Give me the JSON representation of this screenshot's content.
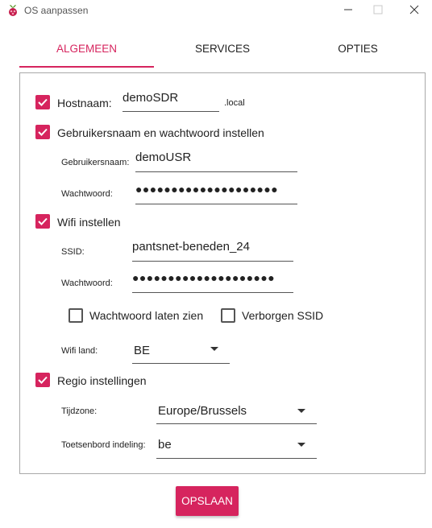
{
  "window": {
    "title": "OS aanpassen"
  },
  "tabs": [
    {
      "label": "ALGEMEEN",
      "active": true
    },
    {
      "label": "SERVICES",
      "active": false
    },
    {
      "label": "OPTIES",
      "active": false
    }
  ],
  "hostname": {
    "checked": true,
    "label": "Hostnaam:",
    "value": "demoSDR",
    "suffix": ".local"
  },
  "user": {
    "checked": true,
    "label": "Gebruikersnaam en wachtwoord instellen",
    "username_label": "Gebruikersnaam:",
    "username_value": "demoUSR",
    "password_label": "Wachtwoord:",
    "password_value": "●●●●●●●●●●●●●●●●●●●●"
  },
  "wifi": {
    "checked": true,
    "label": "Wifi instellen",
    "ssid_label": "SSID:",
    "ssid_value": "pantsnet-beneden_24",
    "password_label": "Wachtwoord:",
    "password_value": "●●●●●●●●●●●●●●●●●●●●",
    "show_password": {
      "checked": false,
      "label": "Wachtwoord laten zien"
    },
    "hidden_ssid": {
      "checked": false,
      "label": "Verborgen SSID"
    },
    "country_label": "Wifi land:",
    "country_value": "BE"
  },
  "locale": {
    "checked": true,
    "label": "Regio instellingen",
    "timezone_label": "Tijdzone:",
    "timezone_value": "Europe/Brussels",
    "keyboard_label": "Toetsenbord indeling:",
    "keyboard_value": "be"
  },
  "footer": {
    "save_label": "OPSLAAN"
  },
  "colors": {
    "accent": "#d6245e",
    "border": "#a9a9a9"
  }
}
